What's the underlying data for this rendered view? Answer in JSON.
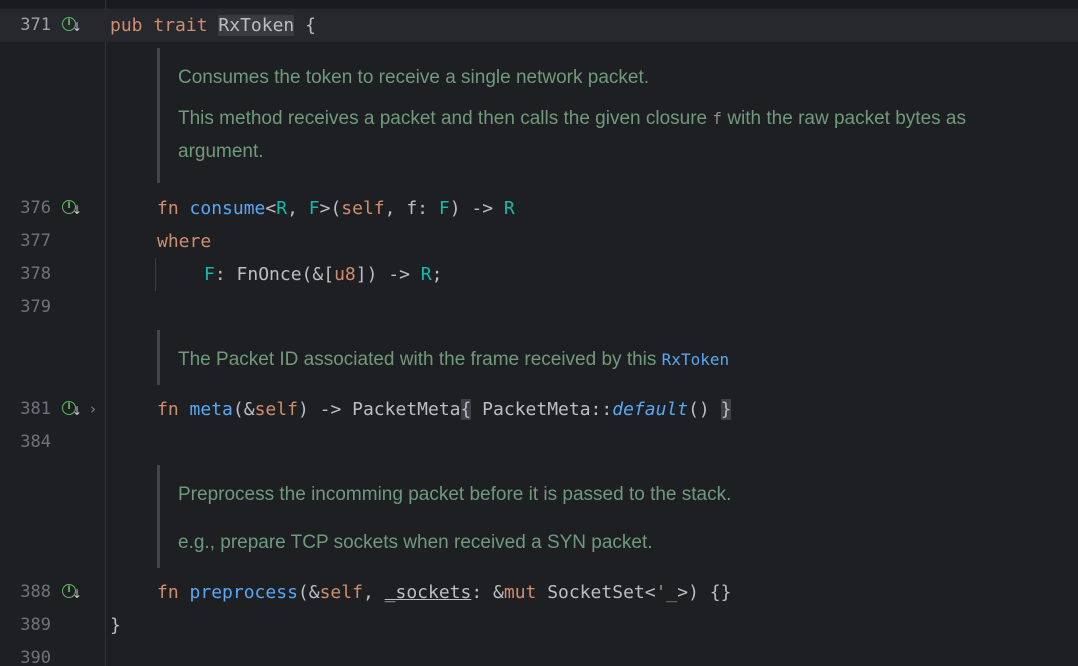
{
  "editor": {
    "line_371": {
      "num": "371",
      "kw1": "pub",
      "kw2": "trait",
      "name": "RxToken",
      "brace": "{"
    },
    "doc1": {
      "p1": "Consumes the token to receive a single network packet.",
      "p2_before": "This method receives a packet and then calls the given closure ",
      "p2_code": "f",
      "p2_after": " with the raw packet bytes as",
      "p2_line2": "argument."
    },
    "line_376": {
      "num": "376",
      "kw": "fn",
      "name": "consume",
      "t1": "<",
      "g1": "R",
      "t2": ", ",
      "g2": "F",
      "t3": ">(",
      "self_kw": "self",
      "t4": ", f: ",
      "g3": "F",
      "t5": ") -> ",
      "g4": "R"
    },
    "line_377": {
      "num": "377",
      "kw": "where"
    },
    "line_378": {
      "num": "378",
      "g1": "F",
      "t1": ": FnOnce(&[",
      "u8": "u8",
      "t2": "]) -> ",
      "g2": "R",
      "t3": ";"
    },
    "line_379": {
      "num": "379"
    },
    "doc2": {
      "before": "The Packet ID associated with the frame received by this ",
      "code": "RxToken"
    },
    "line_381": {
      "num": "381",
      "kw": "fn",
      "name": "meta",
      "t1": "(&",
      "self_kw": "self",
      "t2": ") -> PacketMeta",
      "b_open": "{",
      "t3": " PacketMeta::",
      "method": "default",
      "t4": "() ",
      "b_close": "}"
    },
    "line_384": {
      "num": "384"
    },
    "doc3": {
      "p1": "Preprocess the incomming packet before it is passed to the stack.",
      "p2": "e.g., prepare TCP sockets when received a SYN packet."
    },
    "line_388": {
      "num": "388",
      "kw": "fn",
      "name": "preprocess",
      "t1": "(&",
      "self_kw": "self",
      "t2": ", ",
      "param": "_sockets",
      "t3": ": &",
      "mut_kw": "mut",
      "t4": " SocketSet<",
      "lifetime": "'_",
      "t5": ">) {}"
    },
    "line_389": {
      "num": "389",
      "brace": "}"
    },
    "line_390": {
      "num": "390"
    }
  },
  "icons": {
    "implemented_marker": "implemented-by-icon",
    "fold": "chevron-right-icon"
  },
  "colors": {
    "background": "#1e1f22",
    "keyword": "#cf8e6d",
    "function": "#56a8f5",
    "generic": "#16baac",
    "doc_text": "#6f9a7c",
    "gutter_icon": "#5fb865"
  }
}
